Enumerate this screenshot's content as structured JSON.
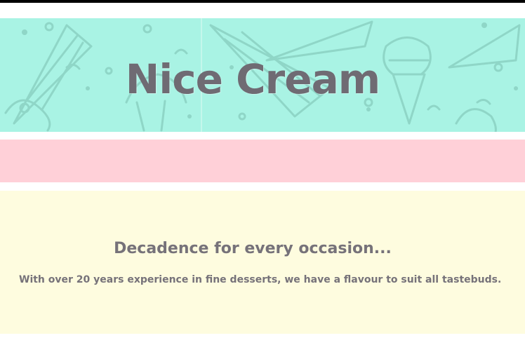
{
  "header": {
    "title": "Nice Cream"
  },
  "colors": {
    "top_bar": "#000000",
    "hero_bg": "#a9f3e4",
    "hero_pattern": "#8fd6c7",
    "title_text": "#6f6b73",
    "nav_band": "#ffd0d8",
    "content_bg": "#fefcdf",
    "body_text": "#767279"
  },
  "main": {
    "heading": "Decadence for every occasion...",
    "description": "With over 20 years experience in fine desserts, we have a flavour to suit all tastebuds."
  },
  "icons": [
    "ice-cream-cone-pattern"
  ]
}
